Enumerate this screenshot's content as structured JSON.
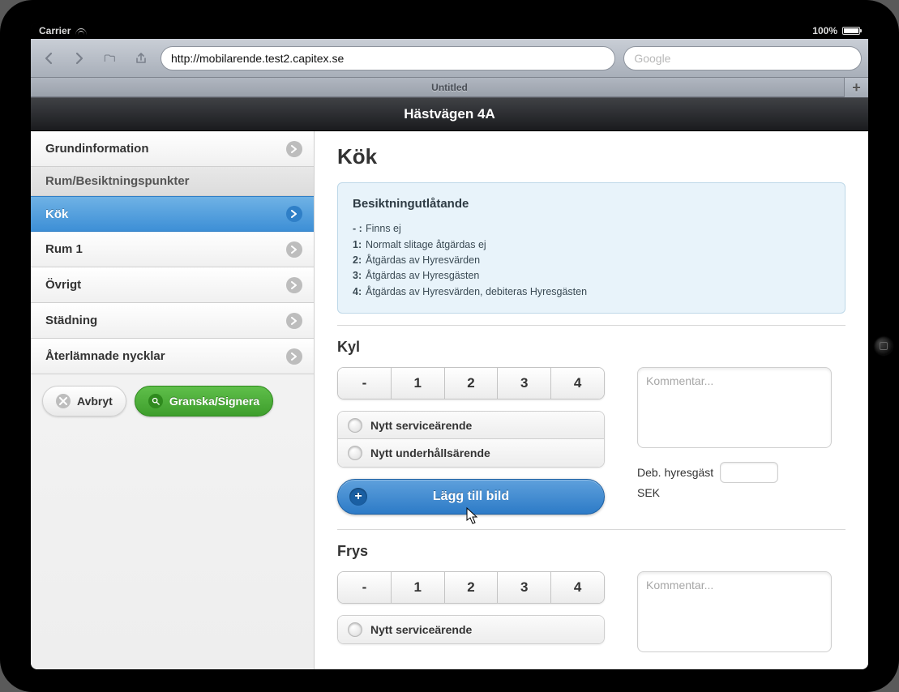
{
  "status": {
    "carrier": "Carrier",
    "battery_pct": "100%"
  },
  "browser": {
    "url": "http://mobilarende.test2.capitex.se",
    "search_placeholder": "Google",
    "tab_title": "Untitled"
  },
  "app": {
    "title": "Hästvägen 4A"
  },
  "sidebar": {
    "items": [
      {
        "label": "Grundinformation",
        "kind": "top"
      },
      {
        "label": "Rum/Besiktningspunkter",
        "kind": "sub"
      },
      {
        "label": "Kök",
        "kind": "indent",
        "active": true
      },
      {
        "label": "Rum 1",
        "kind": "indent"
      },
      {
        "label": "Övrigt",
        "kind": "indent"
      },
      {
        "label": "Städning",
        "kind": "top"
      },
      {
        "label": "Återlämnade nycklar",
        "kind": "top"
      }
    ],
    "cancel_label": "Avbryt",
    "review_label": "Granska/Signera"
  },
  "main": {
    "heading": "Kök",
    "info": {
      "title": "Besiktningutlåtande",
      "rows": [
        {
          "k": "- :",
          "v": "Finns ej"
        },
        {
          "k": "1:",
          "v": "Normalt slitage åtgärdas ej"
        },
        {
          "k": "2:",
          "v": "Åtgärdas av Hyresvärden"
        },
        {
          "k": "3:",
          "v": "Åtgärdas av Hyresgästen"
        },
        {
          "k": "4:",
          "v": "Åtgärdas av Hyresvärden, debiteras Hyresgästen"
        }
      ]
    },
    "segments": [
      "-",
      "1",
      "2",
      "3",
      "4"
    ],
    "radio_options": [
      "Nytt serviceärende",
      "Nytt underhållsärende"
    ],
    "add_image_label": "Lägg till bild",
    "comment_placeholder": "Kommentar...",
    "deb_label": "Deb. hyresgäst",
    "deb_unit": "SEK",
    "sections": [
      {
        "title": "Kyl"
      },
      {
        "title": "Frys"
      }
    ]
  }
}
